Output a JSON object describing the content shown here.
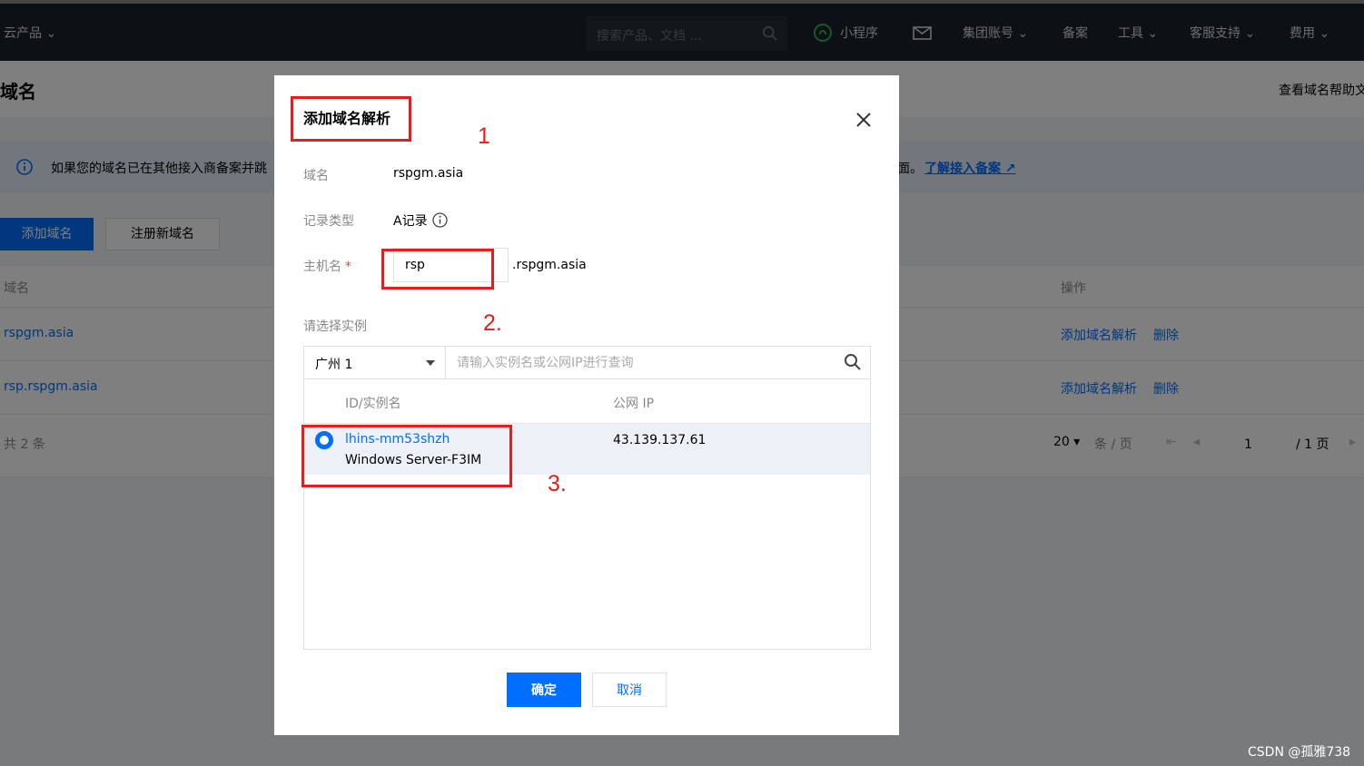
{
  "topnav": {
    "brand": "云产品",
    "search_placeholder": "搜索产品、文档 ...",
    "items": [
      "小程序",
      "集团账号",
      "备案",
      "工具",
      "客服支持",
      "费用"
    ]
  },
  "page": {
    "title": "域名",
    "help_link": "查看域名帮助文"
  },
  "notice": {
    "text": "如果您的域名已在其他接入商备案并跳",
    "text_end": "面。",
    "link": "了解接入备案"
  },
  "toolbar": {
    "add_domain": "添加域名",
    "register_domain": "注册新域名"
  },
  "domain_table": {
    "headers": {
      "domain": "域名",
      "actions": "操作"
    },
    "rows": [
      {
        "domain": "rspgm.asia",
        "action_add": "添加域名解析",
        "action_delete": "删除"
      },
      {
        "domain": "rsp.rspgm.asia",
        "action_add": "添加域名解析",
        "action_delete": "删除"
      }
    ],
    "total": "共 2 条",
    "page_size": "20",
    "page_size_suffix": "条 / 页",
    "current_page": "1",
    "total_pages": "/ 1 页"
  },
  "dialog": {
    "title": "添加域名解析",
    "domain_label": "域名",
    "domain_value": "rspgm.asia",
    "record_type_label": "记录类型",
    "record_type_value": "A记录",
    "host_label": "主机名",
    "host_value": "rsp",
    "host_suffix": ".rspgm.asia",
    "instance_label": "请选择实例",
    "region": "广州 1",
    "search_placeholder": "请输入实例名或公网IP进行查询",
    "table_headers": {
      "id": "ID/实例名",
      "ip": "公网 IP"
    },
    "instances": [
      {
        "id": "lhins-mm53shzh",
        "name": "Windows Server-F3IM",
        "ip": "43.139.137.61",
        "selected": true
      }
    ],
    "ok": "确定",
    "cancel": "取消"
  },
  "annotations": [
    "1",
    "2.",
    "3."
  ],
  "watermark": "CSDN @孤雅738",
  "colors": {
    "primary": "#006eff",
    "annotation": "#e02020",
    "nav_bg": "#1b2128"
  }
}
